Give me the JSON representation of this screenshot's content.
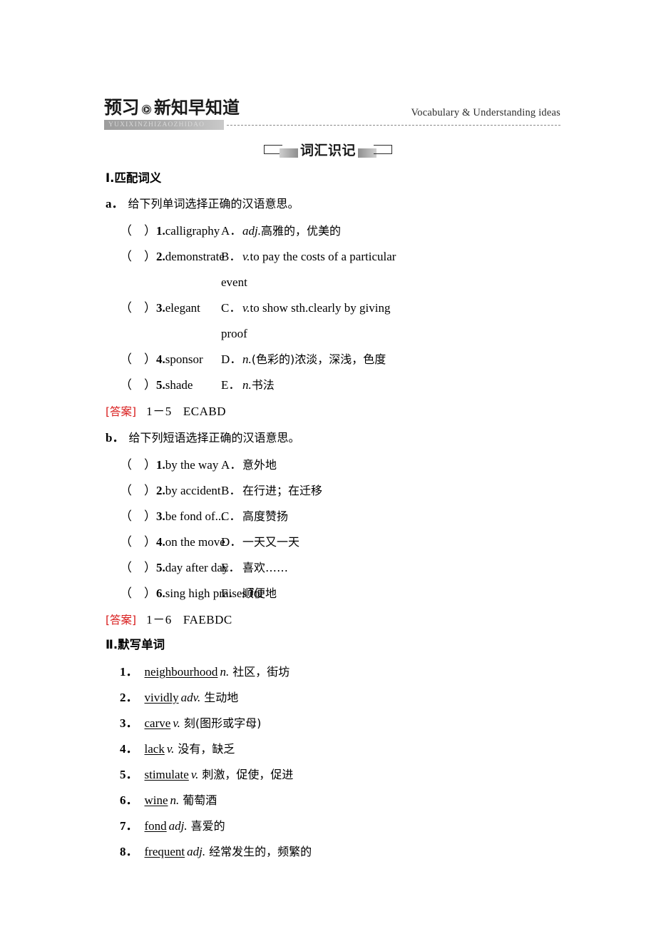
{
  "header": {
    "title_bold": "预习",
    "play_icon": "play-circle-icon",
    "title_rest": "新知早知道",
    "pinyin": "YUXIXINZHIZAOZHIDAO",
    "right_label": "Vocabulary & Understanding ideas"
  },
  "section_title": {
    "text": "词汇识记"
  },
  "part1": {
    "heading": "Ⅰ.匹配词义",
    "sub_a": {
      "label": "a．",
      "instruction": "给下列单词选择正确的汉语意思。"
    },
    "words": [
      {
        "paren": "（　）",
        "num": "1.",
        "term": "calligraphy"
      },
      {
        "paren": "（　）",
        "num": "2.",
        "term": "demonstrate"
      },
      {
        "paren": "（　）",
        "num": "3.",
        "term": "elegant"
      },
      {
        "paren": "（　）",
        "num": "4.",
        "term": "sponsor"
      },
      {
        "paren": "（　）",
        "num": "5.",
        "term": "shade"
      }
    ],
    "definitions": [
      {
        "letter": "A．",
        "pos": "adj.",
        "text": "高雅的，优美的",
        "is_cn": true,
        "wrap": ""
      },
      {
        "letter": "B．",
        "pos": "v.",
        "text": "to pay the costs of a particular",
        "is_cn": false,
        "wrap": "event"
      },
      {
        "letter": "C．",
        "pos": "v.",
        "text": "to show sth.clearly by giving",
        "is_cn": false,
        "wrap": "proof"
      },
      {
        "letter": "D．",
        "pos": "n.",
        "text": "(色彩的)浓淡，深浅，色度",
        "is_cn": true,
        "wrap": ""
      },
      {
        "letter": "E．",
        "pos": "n.",
        "text": "书法",
        "is_cn": true,
        "wrap": ""
      }
    ],
    "answer_a": {
      "label": "[答案]",
      "range": "1－5",
      "codes": "ECABD"
    },
    "sub_b": {
      "label": "b．",
      "instruction": "给下列短语选择正确的汉语意思。"
    },
    "phrases": [
      {
        "paren": "（　）",
        "num": "1.",
        "term": "by the way"
      },
      {
        "paren": "（　）",
        "num": "2.",
        "term": "by accident"
      },
      {
        "paren": "（　）",
        "num": "3.",
        "term": "be fond of..."
      },
      {
        "paren": "（　）",
        "num": "4.",
        "term": "on the move"
      },
      {
        "paren": "（　）",
        "num": "5.",
        "term": "day after day"
      },
      {
        "paren": "（　）",
        "num": "6.",
        "term": "sing high praises for"
      }
    ],
    "meanings": [
      {
        "letter": "A．",
        "text": "意外地"
      },
      {
        "letter": "B．",
        "text": "在行进；在迁移"
      },
      {
        "letter": "C．",
        "text": "高度赞扬"
      },
      {
        "letter": "D．",
        "text": "一天又一天"
      },
      {
        "letter": "E．",
        "text": "喜欢……"
      },
      {
        "letter": "F．",
        "text": "顺便地"
      }
    ],
    "answer_b": {
      "label": "[答案]",
      "range": "1－6",
      "codes": "FAEBDC"
    }
  },
  "part2": {
    "heading": "Ⅱ.默写单词",
    "items": [
      {
        "idx": "1．",
        "word": "neighbourhood",
        "pos": "n.",
        "meaning": "社区，街坊"
      },
      {
        "idx": "2．",
        "word": "vividly",
        "pos": "adv.",
        "meaning": "生动地"
      },
      {
        "idx": "3．",
        "word": "carve",
        "pos": "v.",
        "meaning": "刻(图形或字母)"
      },
      {
        "idx": "4．",
        "word": "lack",
        "pos": "v.",
        "meaning": "没有，缺乏"
      },
      {
        "idx": "5．",
        "word": "stimulate",
        "pos": "v.",
        "meaning": "刺激，促使，促进"
      },
      {
        "idx": "6．",
        "word": "wine",
        "pos": "n.",
        "meaning": "葡萄酒"
      },
      {
        "idx": "7．",
        "word": "fond",
        "pos": "adj.",
        "meaning": "喜爱的"
      },
      {
        "idx": "8．",
        "word": "frequent",
        "pos": "adj.",
        "meaning": "经常发生的，频繁的"
      }
    ]
  },
  "colors": {
    "answer_red": "#d81c1c",
    "banner_gray": "#a5a5a5",
    "text_black": "#000000"
  }
}
